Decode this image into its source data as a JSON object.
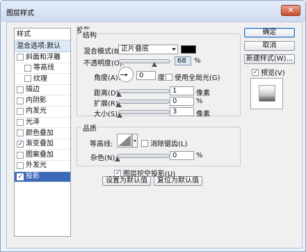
{
  "window": {
    "title": "图层样式",
    "close_icon": "close-icon"
  },
  "style_list": {
    "header": "样式",
    "blend_options": "混合选项:默认",
    "items": [
      {
        "label": "斜面和浮雕",
        "checked": false,
        "sub": false
      },
      {
        "label": "等高线",
        "checked": false,
        "sub": true
      },
      {
        "label": "纹理",
        "checked": false,
        "sub": true
      },
      {
        "label": "描边",
        "checked": false,
        "sub": false
      },
      {
        "label": "内阴影",
        "checked": false,
        "sub": false
      },
      {
        "label": "内发光",
        "checked": false,
        "sub": false
      },
      {
        "label": "光泽",
        "checked": false,
        "sub": false
      },
      {
        "label": "颜色叠加",
        "checked": false,
        "sub": false
      },
      {
        "label": "渐变叠加",
        "checked": true,
        "sub": false
      },
      {
        "label": "图案叠加",
        "checked": false,
        "sub": false
      },
      {
        "label": "外发光",
        "checked": false,
        "sub": false
      },
      {
        "label": "投影",
        "checked": true,
        "sub": false,
        "selected": true
      }
    ]
  },
  "panel": {
    "title": "投影",
    "structure": {
      "title": "结构",
      "blend_mode_label": "混合模式(B):",
      "blend_mode_value": "正片叠底",
      "shadow_color": "#000000",
      "opacity_label": "不透明度(O):",
      "opacity_value": "68",
      "opacity_unit": "%",
      "opacity_level": 0.68,
      "angle_label": "角度(A):",
      "angle_value": "0",
      "angle_unit": "度",
      "global_light_label": "使用全局光(G)",
      "global_light_checked": false,
      "distance_label": "距离(D):",
      "distance_value": "1",
      "distance_unit": "像素",
      "spread_label": "扩展(R):",
      "spread_value": "0",
      "spread_unit": "%",
      "size_label": "大小(S):",
      "size_value": "3",
      "size_unit": "像素"
    },
    "quality": {
      "title": "品质",
      "contour_label": "等高线:",
      "anti_alias_label": "消除锯齿(L)",
      "anti_alias_checked": false,
      "noise_label": "杂色(N):",
      "noise_value": "0",
      "noise_unit": "%"
    },
    "knockout_label": "图层挖空投影(U)",
    "knockout_checked": true,
    "set_default_label": "设置为默认值",
    "reset_default_label": "复位为默认值"
  },
  "buttons": {
    "ok": "确定",
    "cancel": "取消",
    "new_style": "新建样式(W)...",
    "preview_label": "预览(V)",
    "preview_checked": true
  }
}
